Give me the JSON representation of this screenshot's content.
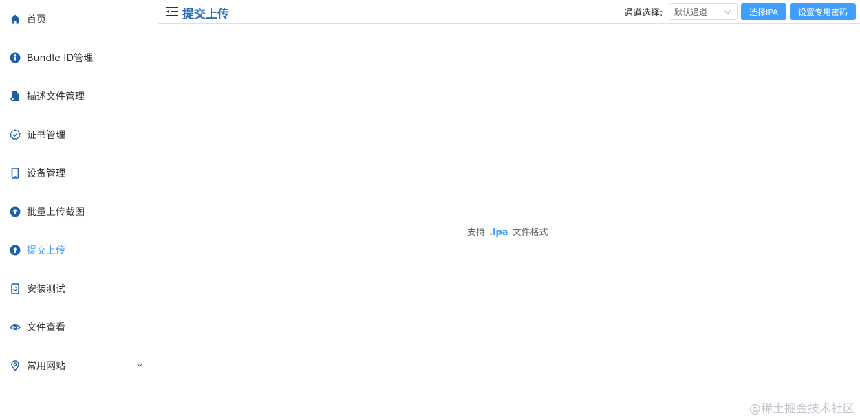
{
  "sidebar": {
    "items": [
      {
        "label": "首页",
        "icon": "home-icon"
      },
      {
        "label": "Bundle ID管理",
        "icon": "info-icon"
      },
      {
        "label": "描述文件管理",
        "icon": "file-gear-icon"
      },
      {
        "label": "证书管理",
        "icon": "shield-check-icon"
      },
      {
        "label": "设备管理",
        "icon": "phone-icon"
      },
      {
        "label": "批量上传截图",
        "icon": "upload-circle-icon"
      },
      {
        "label": "提交上传",
        "icon": "upload-circle-icon",
        "active": true
      },
      {
        "label": "安装测试",
        "icon": "install-icon"
      },
      {
        "label": "文件查看",
        "icon": "eye-icon"
      },
      {
        "label": "常用网站",
        "icon": "location-icon",
        "expandable": true
      }
    ]
  },
  "header": {
    "title": "提交上传",
    "channel_label": "通道选择:",
    "channel_value": "默认通道",
    "select_ipa_label": "选择IPA",
    "set_password_label": "设置专用密码"
  },
  "upload": {
    "hint_prefix": "支持",
    "hint_ext": ".ipa",
    "hint_suffix": "文件格式"
  },
  "watermark": "@稀土掘金技术社区",
  "colors": {
    "accent": "#409eff",
    "title": "#2f6fb5",
    "icon": "#1f5fa8"
  }
}
